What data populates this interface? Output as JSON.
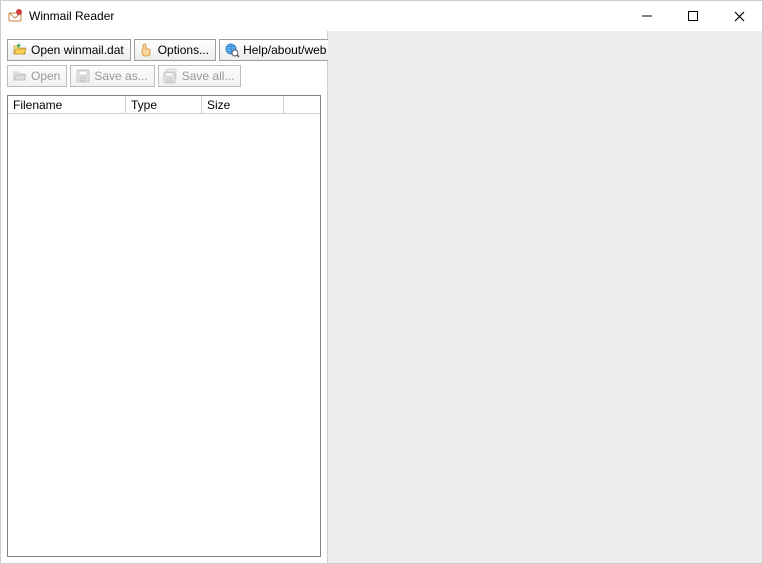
{
  "titlebar": {
    "title": "Winmail Reader"
  },
  "toolbar1": {
    "open_winmail": "Open winmail.dat",
    "options": "Options...",
    "help": "Help/about/web"
  },
  "toolbar2": {
    "open": "Open",
    "save_as": "Save as...",
    "save_all": "Save all..."
  },
  "listview": {
    "columns": {
      "filename": "Filename",
      "type": "Type",
      "size": "Size"
    },
    "rows": []
  }
}
